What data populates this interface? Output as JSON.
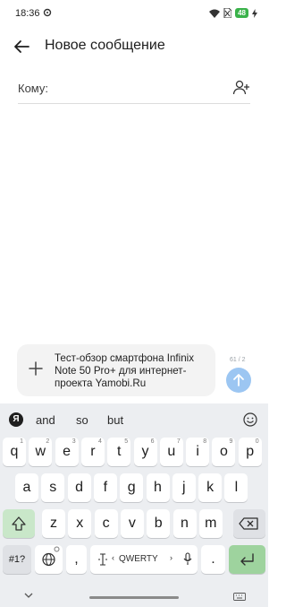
{
  "status": {
    "time": "18:36",
    "battery": "48"
  },
  "header": {
    "title": "Новое сообщение"
  },
  "recipient": {
    "label": "Кому:"
  },
  "composer": {
    "message": "Тест-обзор смартфона Infinix Note 50 Pro+ для интернет-проекта Yamobi.Ru",
    "counter": "61 / 2"
  },
  "keyboard": {
    "suggestions": [
      "and",
      "so",
      "but"
    ],
    "row1": [
      {
        "k": "q",
        "h": "1"
      },
      {
        "k": "w",
        "h": "2"
      },
      {
        "k": "e",
        "h": "3"
      },
      {
        "k": "r",
        "h": "4"
      },
      {
        "k": "t",
        "h": "5"
      },
      {
        "k": "y",
        "h": "6"
      },
      {
        "k": "u",
        "h": "7"
      },
      {
        "k": "i",
        "h": "8"
      },
      {
        "k": "o",
        "h": "9"
      },
      {
        "k": "p",
        "h": "0"
      }
    ],
    "row2": [
      "a",
      "s",
      "d",
      "f",
      "g",
      "h",
      "j",
      "k",
      "l"
    ],
    "row3": [
      "z",
      "x",
      "c",
      "v",
      "b",
      "n",
      "m"
    ],
    "symbols_label": "#1?",
    "comma": ",",
    "space_label": "QWERTY",
    "period": "."
  },
  "colors": {
    "accent_send": "#9cc6f2",
    "enter_key": "#9ed39e",
    "shift_key": "#c9e7c9"
  }
}
